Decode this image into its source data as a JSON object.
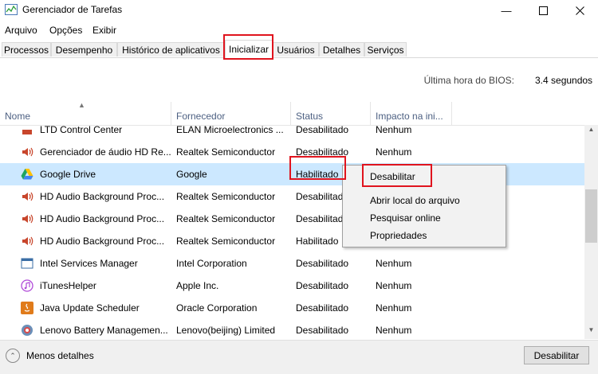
{
  "window": {
    "title": "Gerenciador de Tarefas"
  },
  "menu": [
    "Arquivo",
    "Opções",
    "Exibir"
  ],
  "tabs": [
    "Processos",
    "Desempenho",
    "Histórico de aplicativos",
    "Inicializar",
    "Usuários",
    "Detalhes",
    "Serviços"
  ],
  "active_tab": "Inicializar",
  "bios": {
    "label": "Última hora do BIOS:",
    "value": "3.4 segundos"
  },
  "columns": [
    "Nome",
    "Fornecedor",
    "Status",
    "Impacto na ini..."
  ],
  "rows": [
    {
      "name": "LTD Control Center",
      "vendor": "ELAN Microelectronics ...",
      "status": "Desabilitado",
      "impact": "Nenhum",
      "icon": "generic-app-icon"
    },
    {
      "name": "Gerenciador de áudio HD Re...",
      "vendor": "Realtek Semiconductor",
      "status": "Desabilitado",
      "impact": "Nenhum",
      "icon": "speaker-icon"
    },
    {
      "name": "Google Drive",
      "vendor": "Google",
      "status": "Habilitado",
      "impact": "",
      "icon": "google-drive-icon"
    },
    {
      "name": "HD Audio Background Proc...",
      "vendor": "Realtek Semiconductor",
      "status": "Desabilitado",
      "impact": "",
      "icon": "speaker-icon"
    },
    {
      "name": "HD Audio Background Proc...",
      "vendor": "Realtek Semiconductor",
      "status": "Desabilitado",
      "impact": "",
      "icon": "speaker-icon"
    },
    {
      "name": "HD Audio Background Proc...",
      "vendor": "Realtek Semiconductor",
      "status": "Habilitado",
      "impact": "",
      "icon": "speaker-icon"
    },
    {
      "name": "Intel Services Manager",
      "vendor": "Intel Corporation",
      "status": "Desabilitado",
      "impact": "Nenhum",
      "icon": "window-app-icon"
    },
    {
      "name": "iTunesHelper",
      "vendor": "Apple Inc.",
      "status": "Desabilitado",
      "impact": "Nenhum",
      "icon": "itunes-icon"
    },
    {
      "name": "Java Update Scheduler",
      "vendor": "Oracle Corporation",
      "status": "Desabilitado",
      "impact": "Nenhum",
      "icon": "java-icon"
    },
    {
      "name": "Lenovo Battery Managemen...",
      "vendor": "Lenovo(beijing) Limited",
      "status": "Desabilitado",
      "impact": "Nenhum",
      "icon": "lenovo-icon"
    }
  ],
  "context_menu": [
    "Desabilitar",
    "Abrir local do arquivo",
    "Pesquisar online",
    "Propriedades"
  ],
  "footer": {
    "less_details": "Menos detalhes",
    "disable_button": "Desabilitar"
  },
  "colors": {
    "selection": "#cce8ff",
    "highlight_box": "#e0141e",
    "header_text": "#4d6082"
  }
}
